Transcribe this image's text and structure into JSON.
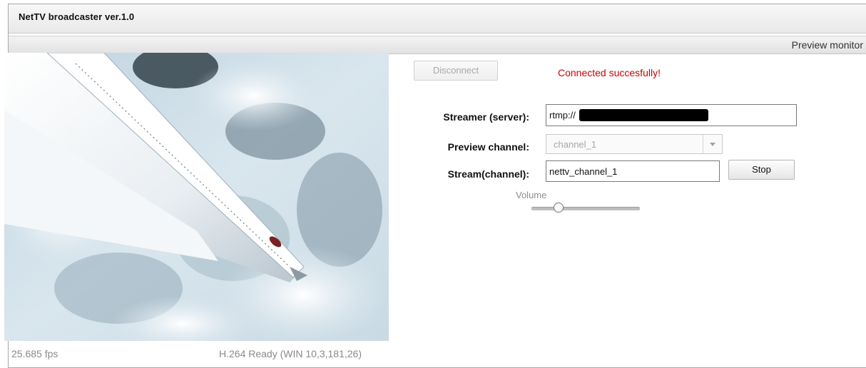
{
  "window": {
    "title": "NetTV broadcaster ver.1.0"
  },
  "subheader": {
    "label": "Preview monitor"
  },
  "controls": {
    "disconnect_label": "Disconnect",
    "status_message": "Connected succesfully!",
    "streamer_label": "Streamer (server):",
    "streamer_value": "rtmp://",
    "preview_label": "Preview channel:",
    "preview_selected": "channel_1",
    "stream_label": "Stream(channel):",
    "stream_value": "nettv_channel_1",
    "stop_label": "Stop",
    "volume_label": "Volume",
    "volume_level_fraction": 0.25
  },
  "video": {
    "fps_text": "25.685 fps",
    "codec_text": "H.264 Ready (WIN 10,3,181,26)"
  },
  "colors": {
    "status_message": "#cc0000",
    "muted_text": "#8a8a8a"
  }
}
